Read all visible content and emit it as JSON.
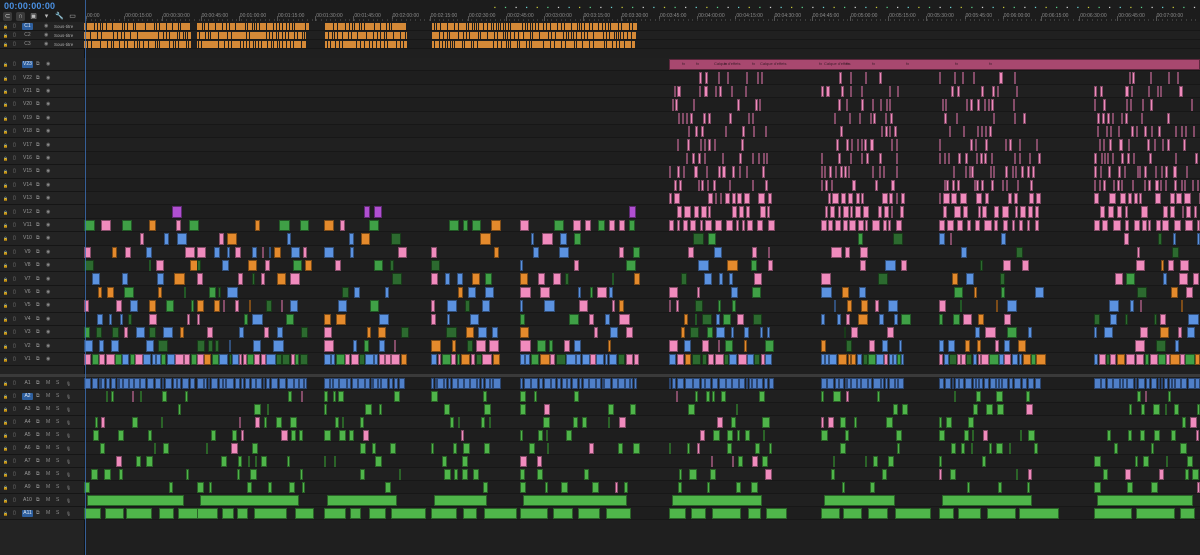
{
  "sequence": {
    "timecode": "00:00:00:00"
  },
  "toolbar": {
    "tools": [
      {
        "name": "snap-icon",
        "glyph": "⊂"
      },
      {
        "name": "linked-selection-icon",
        "glyph": "∩"
      },
      {
        "name": "nest-icon",
        "glyph": "▣"
      },
      {
        "name": "marker-icon",
        "glyph": "▾"
      },
      {
        "name": "wrench-icon",
        "glyph": "🔧"
      },
      {
        "name": "captions-icon",
        "glyph": "▭"
      }
    ]
  },
  "ruler": {
    "labels": [
      "00:00",
      "00:00:15:00",
      "00:00:30:00",
      "00:00:45:00",
      "00:01:00:00",
      "00:01:15:00",
      "00:01:30:00",
      "00:01:45:00",
      "00:02:00:00",
      "00:02:15:00",
      "00:02:30:00",
      "00:02:45:00",
      "00:03:00:00",
      "00:03:15:00",
      "00:03:30:00",
      "00:03:45:00",
      "00:04:00:00",
      "00:04:15:00",
      "00:04:30:00",
      "00:04:45:00",
      "00:05:00:00",
      "00:05:15:00",
      "00:05:30:00",
      "00:05:45:00",
      "00:06:00:00",
      "00:06:15:00",
      "00:06:30:00",
      "00:06:45:00",
      "00:07:00:00",
      "00:07:15:00"
    ]
  },
  "tracks": {
    "subtitle": [
      {
        "name": "C1",
        "label": "Sous-titre"
      },
      {
        "name": "C2",
        "label": "Sous-titre"
      },
      {
        "name": "C3",
        "label": "Sous-titre"
      }
    ],
    "video": [
      "V23",
      "V22",
      "V21",
      "V20",
      "V19",
      "V18",
      "V17",
      "V16",
      "V15",
      "V14",
      "V13",
      "V12",
      "V11",
      "V10",
      "V9",
      "V8",
      "V7",
      "V6",
      "V5",
      "V4",
      "V3",
      "V2",
      "V1"
    ],
    "audio": [
      "A1",
      "A2",
      "A3",
      "A4",
      "A5",
      "A6",
      "A7",
      "A8",
      "A9",
      "A10",
      "A11"
    ],
    "audio_buttons": {
      "mute": "M",
      "solo": "S"
    }
  },
  "clips": {
    "adjustment_label": "Calque d'effets",
    "fx_badge": "fx"
  },
  "colors": {
    "subtitle": "#e8953a",
    "adjustment": "#a8486f",
    "pink": "#f08bbd",
    "blue": "#5b92e0",
    "green": "#3fa046",
    "dark_green": "#2c6a2f",
    "orange": "#e48a2c",
    "purple": "#b04fd1",
    "audio": "#4fb54a",
    "accent": "#4a90e2"
  }
}
